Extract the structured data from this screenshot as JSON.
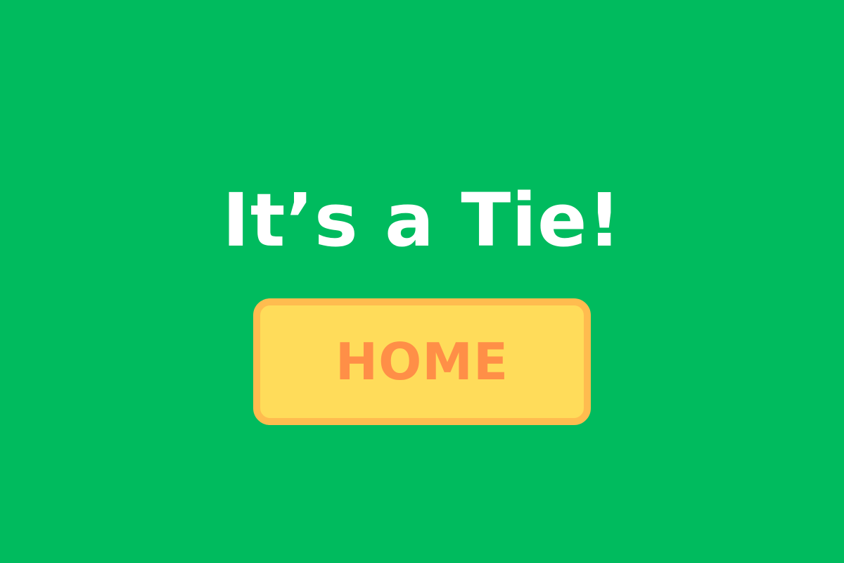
{
  "screen": {
    "background_color": "#00bb5e",
    "title": "It’s a Tie!",
    "title_color": "#ffffff"
  },
  "home_button": {
    "label": "HOME",
    "background_color": "#ffdc5a",
    "border_color": "#ffbc4f",
    "text_color": "#ff8f47"
  }
}
